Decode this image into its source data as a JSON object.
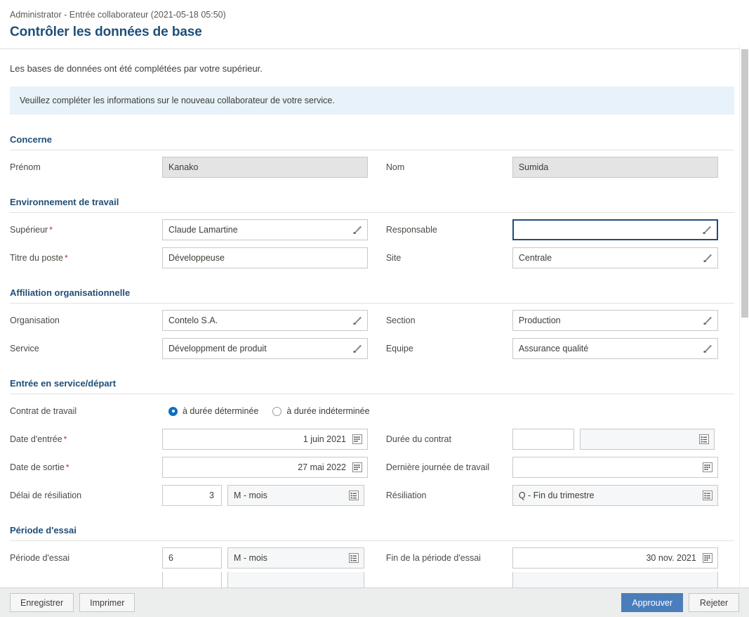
{
  "header": {
    "breadcrumb": "Administrator - Entrée collaborateur (2021-05-18 05:50)",
    "title": "Contrôler les données de base"
  },
  "intro": {
    "subtext": "Les bases de données ont été complétées par votre supérieur.",
    "banner": "Veuillez compléter les informations sur le nouveau collaborateur de votre service."
  },
  "sections": {
    "concerne": {
      "title": "Concerne",
      "prenom_label": "Prénom",
      "prenom_value": "Kanako",
      "nom_label": "Nom",
      "nom_value": "Sumida"
    },
    "environnement": {
      "title": "Environnement de travail",
      "superieur_label": "Supérieur",
      "superieur_value": "Claude Lamartine",
      "responsable_label": "Responsable",
      "responsable_value": "",
      "titre_poste_label": "Titre du poste",
      "titre_poste_value": "Développeuse",
      "site_label": "Site",
      "site_value": "Centrale"
    },
    "affiliation": {
      "title": "Affiliation organisationnelle",
      "organisation_label": "Organisation",
      "organisation_value": "Contelo S.A.",
      "section_label": "Section",
      "section_value": "Production",
      "service_label": "Service",
      "service_value": "Développment de produit",
      "equipe_label": "Equipe",
      "equipe_value": "Assurance qualité"
    },
    "entree": {
      "title": "Entrée en service/départ",
      "contrat_label": "Contrat de travail",
      "contrat_option_1": "à durée déterminée",
      "contrat_option_2": "à durée indéterminée",
      "date_entree_label": "Date d'entrée",
      "date_entree_value": "1 juin 2021",
      "duree_contrat_label": "Durée du contrat",
      "duree_contrat_num": "",
      "duree_contrat_unit": "",
      "date_sortie_label": "Date de sortie",
      "date_sortie_value": "27 mai 2022",
      "derniere_journee_label": "Dernière journée de travail",
      "derniere_journee_value": "",
      "delai_resiliation_label": "Délai de résiliation",
      "delai_resiliation_num": "3",
      "delai_resiliation_unit": "M - mois",
      "resiliation_label": "Résiliation",
      "resiliation_value": "Q - Fin du trimestre"
    },
    "essai": {
      "title": "Période d'essai",
      "periode_label": "Période d'essai",
      "periode_num": "6",
      "periode_unit": "M - mois",
      "fin_periode_label": "Fin de la période d'essai",
      "fin_periode_value": "30 nov. 2021"
    }
  },
  "footer": {
    "enregistrer": "Enregistrer",
    "imprimer": "Imprimer",
    "approuver": "Approuver",
    "rejeter": "Rejeter"
  },
  "colors": {
    "accent_blue": "#1f4e79",
    "primary_button": "#4a7ebb",
    "banner_bg": "#e8f2fa",
    "radio_selected": "#0b6fc4",
    "required_star": "#b03030"
  }
}
